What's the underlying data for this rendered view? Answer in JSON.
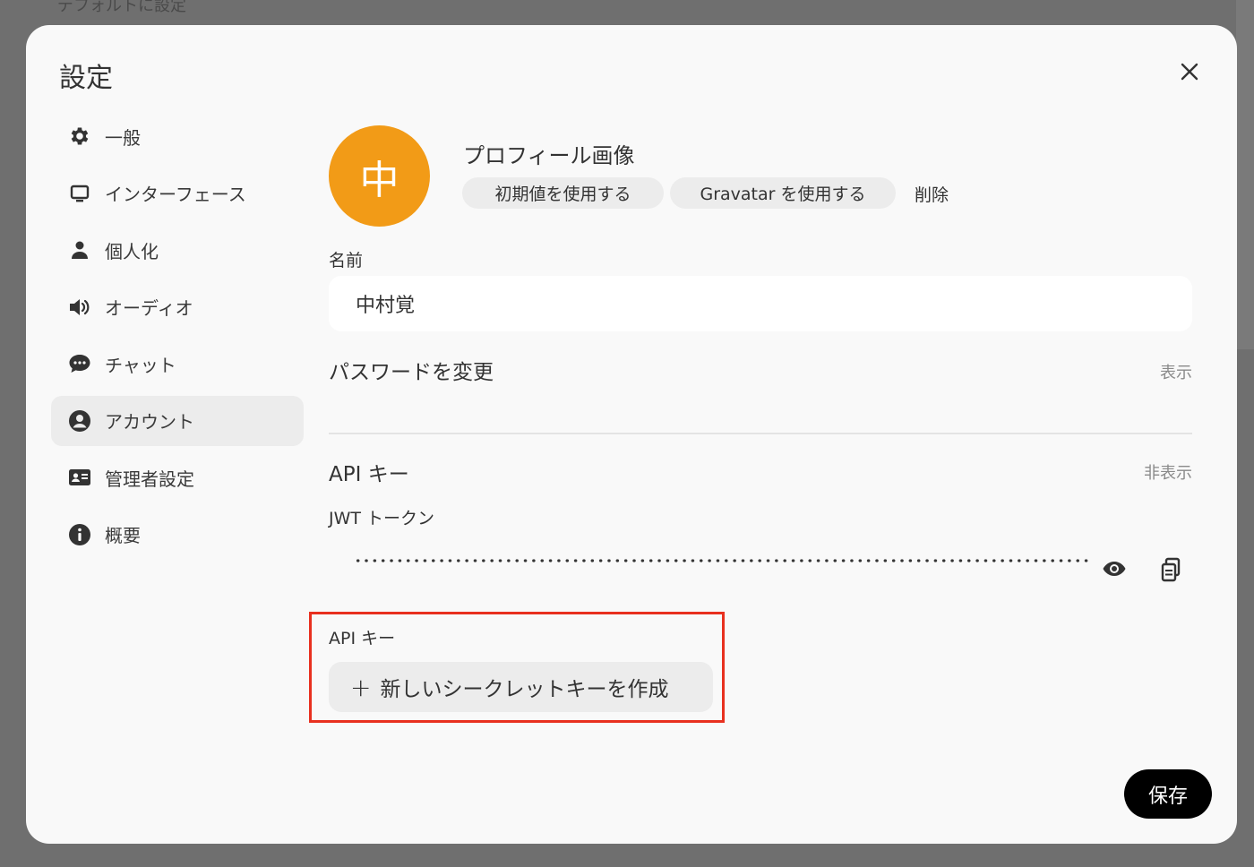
{
  "backdrop": {
    "text": "デフォルトに設定"
  },
  "modal": {
    "title": "設定"
  },
  "sidebar": {
    "items": [
      {
        "label": "一般",
        "icon": "gear-icon"
      },
      {
        "label": "インターフェース",
        "icon": "monitor-icon"
      },
      {
        "label": "個人化",
        "icon": "user-icon"
      },
      {
        "label": "オーディオ",
        "icon": "speaker-icon"
      },
      {
        "label": "チャット",
        "icon": "chat-icon"
      },
      {
        "label": "アカウント",
        "icon": "account-circle-icon",
        "active": true
      },
      {
        "label": "管理者設定",
        "icon": "id-card-icon"
      },
      {
        "label": "概要",
        "icon": "info-icon"
      }
    ]
  },
  "account": {
    "avatar_char": "中",
    "avatar_color": "#f29b17",
    "profile_image_label": "プロフィール画像",
    "use_default_label": "初期値を使用する",
    "use_gravatar_label": "Gravatar を使用する",
    "delete_label": "削除",
    "name_label": "名前",
    "name_value": "中村覚",
    "change_password_label": "パスワードを変更",
    "password_toggle": "表示",
    "api_keys_label": "API キー",
    "api_keys_toggle": "非表示",
    "jwt_label": "JWT トークン",
    "api_key_sublabel": "API キー",
    "create_secret_label": "新しいシークレットキーを作成"
  },
  "footer": {
    "save_label": "保存"
  },
  "colors": {
    "highlight": "#e8301f",
    "accent": "#000000"
  }
}
